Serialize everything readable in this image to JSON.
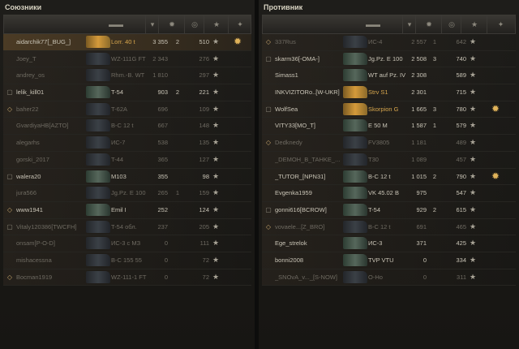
{
  "allies": {
    "title": "Союзники",
    "rows": [
      {
        "plat": "",
        "name": "aidarchik77[_BUG_]",
        "tank": "Lorr. 40 t",
        "dmg": "3 355",
        "frags": "2",
        "score": "510",
        "badge": true,
        "hl": true,
        "dead": false,
        "premium": true
      },
      {
        "plat": "",
        "name": "Joey_T",
        "tank": "WZ-111G FT",
        "dmg": "2 343",
        "frags": "",
        "score": "276",
        "badge": false,
        "hl": false,
        "dead": true,
        "premium": false
      },
      {
        "plat": "",
        "name": "andrey_os",
        "tank": "Rhm.-B. WT",
        "dmg": "1 810",
        "frags": "",
        "score": "297",
        "badge": false,
        "hl": false,
        "dead": true,
        "premium": false
      },
      {
        "plat": "▢",
        "name": "lelik_kill01",
        "tank": "T-54",
        "dmg": "903",
        "frags": "2",
        "score": "221",
        "badge": false,
        "hl": false,
        "dead": false,
        "premium": false
      },
      {
        "plat": "◇",
        "name": "baher22",
        "tank": "T-62A",
        "dmg": "696",
        "frags": "",
        "score": "109",
        "badge": false,
        "hl": false,
        "dead": true,
        "premium": false
      },
      {
        "plat": "",
        "name": "GvardiyaHB[AZTO]",
        "tank": "B-C 12 t",
        "dmg": "667",
        "frags": "",
        "score": "148",
        "badge": false,
        "hl": false,
        "dead": true,
        "premium": false
      },
      {
        "plat": "",
        "name": "alegarhs",
        "tank": "ИС-7",
        "dmg": "538",
        "frags": "",
        "score": "135",
        "badge": false,
        "hl": false,
        "dead": true,
        "premium": false
      },
      {
        "plat": "",
        "name": "gorski_2017",
        "tank": "T-44",
        "dmg": "365",
        "frags": "",
        "score": "127",
        "badge": false,
        "hl": false,
        "dead": true,
        "premium": false
      },
      {
        "plat": "▢",
        "name": "walera20",
        "tank": "M103",
        "dmg": "355",
        "frags": "",
        "score": "98",
        "badge": false,
        "hl": false,
        "dead": false,
        "premium": false
      },
      {
        "plat": "",
        "name": "jura566",
        "tank": "Jg.Pz. E 100",
        "dmg": "265",
        "frags": "1",
        "score": "159",
        "badge": false,
        "hl": false,
        "dead": true,
        "premium": false
      },
      {
        "plat": "◇",
        "name": "www1941",
        "tank": "Emil I",
        "dmg": "252",
        "frags": "",
        "score": "124",
        "badge": false,
        "hl": false,
        "dead": false,
        "premium": false
      },
      {
        "plat": "▢",
        "name": "Vitaly120386[TWCFH]",
        "tank": "T-54 обл.",
        "dmg": "237",
        "frags": "",
        "score": "205",
        "badge": false,
        "hl": false,
        "dead": true,
        "premium": false
      },
      {
        "plat": "",
        "name": "onsam[P-O-D]",
        "tank": "ИС-3 с МЗ",
        "dmg": "0",
        "frags": "",
        "score": "111",
        "badge": false,
        "hl": false,
        "dead": true,
        "premium": false
      },
      {
        "plat": "",
        "name": "mishacessna",
        "tank": "B-C 155 55",
        "dmg": "0",
        "frags": "",
        "score": "72",
        "badge": false,
        "hl": false,
        "dead": true,
        "premium": false
      },
      {
        "plat": "◇",
        "name": "Bocman1919",
        "tank": "WZ-111-1 FT",
        "dmg": "0",
        "frags": "",
        "score": "72",
        "badge": false,
        "hl": false,
        "dead": true,
        "premium": false
      }
    ]
  },
  "enemies": {
    "title": "Противник",
    "rows": [
      {
        "plat": "◇",
        "name": "337Rus",
        "tank": "ИС-4",
        "dmg": "2 557",
        "frags": "1",
        "score": "642",
        "badge": false,
        "hl": false,
        "dead": true,
        "premium": false
      },
      {
        "plat": "▢",
        "name": "skarm36[-OMA-]",
        "tank": "Jg.Pz. E 100",
        "dmg": "2 508",
        "frags": "3",
        "score": "740",
        "badge": false,
        "hl": false,
        "dead": false,
        "premium": false
      },
      {
        "plat": "",
        "name": "Simass1",
        "tank": "WT auf Pz. IV",
        "dmg": "2 308",
        "frags": "",
        "score": "589",
        "badge": false,
        "hl": false,
        "dead": false,
        "premium": false
      },
      {
        "plat": "",
        "name": "INKVIZITORo..[W-UKR]",
        "tank": "Strv S1",
        "dmg": "2 301",
        "frags": "",
        "score": "715",
        "badge": false,
        "hl": false,
        "dead": false,
        "premium": true
      },
      {
        "plat": "▢",
        "name": "WolfSea",
        "tank": "Skorpion G",
        "dmg": "1 665",
        "frags": "3",
        "score": "780",
        "badge": true,
        "hl": false,
        "dead": false,
        "premium": true
      },
      {
        "plat": "",
        "name": "VITY33[MO_T]",
        "tank": "E 50 M",
        "dmg": "1 587",
        "frags": "1",
        "score": "579",
        "badge": false,
        "hl": false,
        "dead": false,
        "premium": false
      },
      {
        "plat": "◇",
        "name": "Dedknedy",
        "tank": "FV3805",
        "dmg": "1 181",
        "frags": "",
        "score": "489",
        "badge": false,
        "hl": false,
        "dead": true,
        "premium": false
      },
      {
        "plat": "",
        "name": "_DEMOH_B_TAHKE_...",
        "tank": "T30",
        "dmg": "1 089",
        "frags": "",
        "score": "457",
        "badge": false,
        "hl": false,
        "dead": true,
        "premium": false
      },
      {
        "plat": "",
        "name": "_TUTOR_[NPN31]",
        "tank": "B-C 12 t",
        "dmg": "1 015",
        "frags": "2",
        "score": "790",
        "badge": true,
        "hl": false,
        "dead": false,
        "premium": false
      },
      {
        "plat": "",
        "name": "Evgenka1959",
        "tank": "VK 45.02 B",
        "dmg": "975",
        "frags": "",
        "score": "547",
        "badge": false,
        "hl": false,
        "dead": false,
        "premium": false
      },
      {
        "plat": "▢",
        "name": "gonni616[BCROW]",
        "tank": "T-54",
        "dmg": "929",
        "frags": "2",
        "score": "615",
        "badge": false,
        "hl": false,
        "dead": false,
        "premium": false
      },
      {
        "plat": "◇",
        "name": "vovaele...[Z_BRO]",
        "tank": "B-C 12 t",
        "dmg": "691",
        "frags": "",
        "score": "465",
        "badge": false,
        "hl": false,
        "dead": true,
        "premium": false
      },
      {
        "plat": "",
        "name": "Ege_strelok",
        "tank": "ИС-3",
        "dmg": "371",
        "frags": "",
        "score": "425",
        "badge": false,
        "hl": false,
        "dead": false,
        "premium": false
      },
      {
        "plat": "",
        "name": "bonni2008",
        "tank": "TVP VTU",
        "dmg": "0",
        "frags": "",
        "score": "334",
        "badge": false,
        "hl": false,
        "dead": false,
        "premium": false
      },
      {
        "plat": "",
        "name": "_SNOvA_v..._[S-NOW]",
        "tank": "O-Ho",
        "dmg": "0",
        "frags": "",
        "score": "311",
        "badge": false,
        "hl": false,
        "dead": true,
        "premium": false
      }
    ]
  },
  "icons": {
    "sort_arrow": "chevron-down-icon",
    "star": "star-icon",
    "badge": "medal-icon"
  }
}
